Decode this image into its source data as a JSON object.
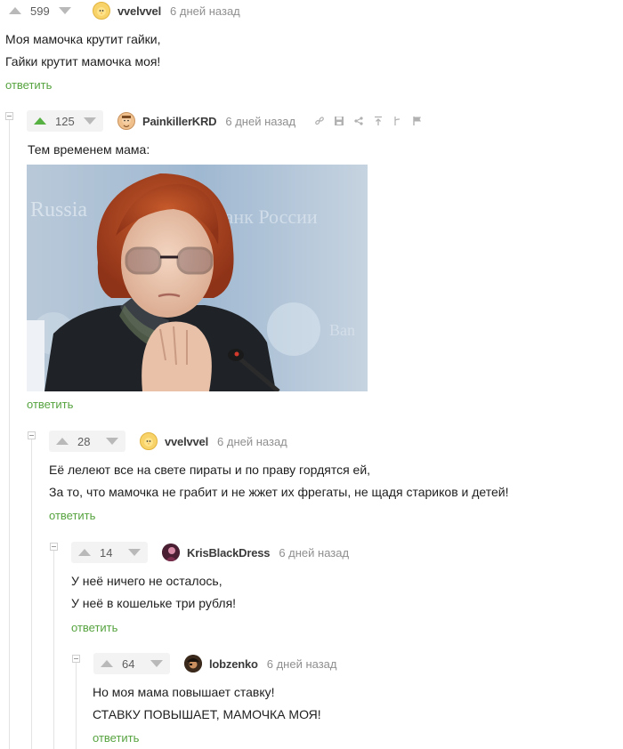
{
  "colors": {
    "accent_green": "#56b142",
    "reply_green": "#56a33f",
    "muted": "#8f8f8f",
    "line": "#e3e3e3"
  },
  "comments": [
    {
      "rating": "599",
      "username": "vvelvvel",
      "time": "6 дней назад",
      "lines": [
        "Моя мамочка крутит гайки,",
        "Гайки крутит мамочка моя!"
      ],
      "reply": "ответить",
      "avatar_icon": "chick-avatar"
    },
    {
      "rating": "125",
      "username": "PainkillerKRD",
      "time": "6 дней назад",
      "lines": [
        "Тем временем мама:"
      ],
      "reply": "ответить",
      "avatar_icon": "cartoon-avatar",
      "tools": [
        "link-icon",
        "save-icon",
        "share-icon",
        "upload-icon",
        "branch-icon",
        "flag-icon"
      ]
    },
    {
      "rating": "28",
      "username": "vvelvvel",
      "time": "6 дней назад",
      "lines": [
        "Её лелеют все на свете пираты и по праву гордятся ей,",
        "За то, что мамочка не грабит и не жжет их фрегаты, не щадя стариков и детей!"
      ],
      "reply": "ответить",
      "avatar_icon": "chick-avatar"
    },
    {
      "rating": "14",
      "username": "KrisBlackDress",
      "time": "6 дней назад",
      "lines": [
        "У неё ничего не осталось,",
        "У неё в кошельке три рубля!"
      ],
      "reply": "ответить",
      "avatar_icon": "portrait-avatar"
    },
    {
      "rating": "64",
      "username": "lobzenko",
      "time": "6 дней назад",
      "lines": [
        "Но моя мама повышает ставку!",
        "СТАВКУ ПОВЫШАЕТ, МАМОЧКА МОЯ!"
      ],
      "reply": "ответить",
      "avatar_icon": "pirate-avatar"
    }
  ]
}
